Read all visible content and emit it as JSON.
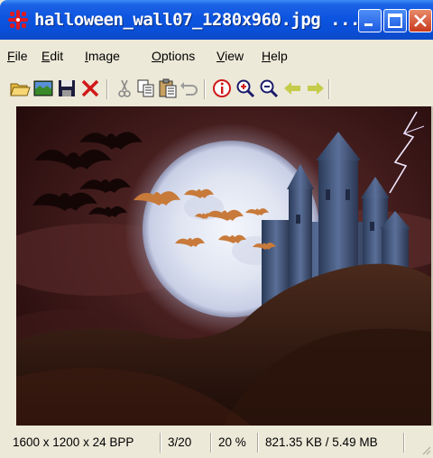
{
  "window": {
    "title": "halloween_wall07_1280x960.jpg ...",
    "buttons": {
      "minimize": "minimize",
      "maximize": "maximize",
      "close": "close"
    }
  },
  "menu": {
    "items": [
      {
        "label": "File",
        "mnemonic": "F",
        "rest": "ile"
      },
      {
        "label": "Edit",
        "mnemonic": "E",
        "rest": "dit"
      },
      {
        "label": "Image",
        "mnemonic": "I",
        "rest": "mage"
      },
      {
        "label": "Options",
        "mnemonic": "O",
        "rest": "ptions"
      },
      {
        "label": "View",
        "mnemonic": "V",
        "rest": "iew"
      },
      {
        "label": "Help",
        "mnemonic": "H",
        "rest": "elp"
      }
    ]
  },
  "toolbar": {
    "icons": [
      "open-folder-icon",
      "thumbnails-icon",
      "save-icon",
      "delete-icon",
      "cut-icon",
      "copy-icon",
      "paste-icon",
      "undo-icon",
      "info-icon",
      "zoom-in-icon",
      "zoom-out-icon",
      "previous-icon",
      "next-icon"
    ]
  },
  "status": {
    "dimensions": "1600 x 1200 x 24 BPP",
    "index": "3/20",
    "zoom": "20 %",
    "size": "821.35 KB / 5.49 MB"
  },
  "colors": {
    "titlebar": "#0d55e0",
    "close": "#c8391d",
    "window_bg": "#ece9d8",
    "sky": "#3a1414",
    "moon": "#e8ecf8"
  }
}
